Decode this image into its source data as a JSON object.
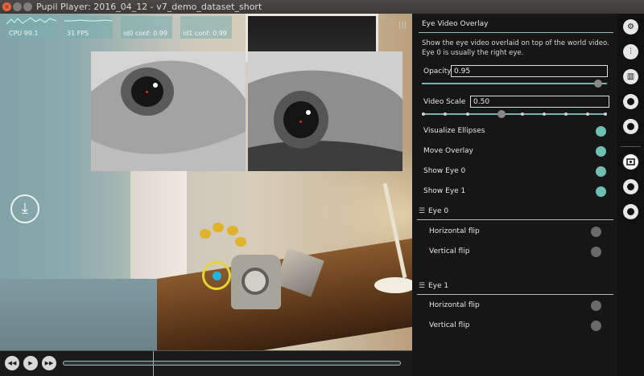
{
  "window": {
    "title": "Pupil Player: 2016_04_12 - v7_demo_dataset_short",
    "close_glyph": "×",
    "min_glyph": "",
    "max_glyph": ""
  },
  "hud": {
    "cpu": "CPU 99.1",
    "fps": "31 FPS",
    "id0": "id0 conf: 0.99",
    "id1": "id1 conf: 0.99"
  },
  "world": {
    "grip_glyph": "|||",
    "download_glyph": "⤓"
  },
  "timeline": {
    "back_glyph": "◀◀",
    "play_glyph": "▶",
    "forward_glyph": "▶▶"
  },
  "panel": {
    "title": "Eye Video Overlay",
    "description": "Show the eye video overlaid on top of the world video. Eye 0 is usually the right eye.",
    "opacity_label": "Opacity",
    "opacity_value": "0.95",
    "opacity_fraction": 0.95,
    "video_scale_label": "Video Scale",
    "video_scale_value": "0.50",
    "toggles": [
      {
        "label": "Visualize Ellipses",
        "on": true
      },
      {
        "label": "Move Overlay",
        "on": true
      },
      {
        "label": "Show Eye 0",
        "on": true
      },
      {
        "label": "Show Eye 1",
        "on": true
      }
    ],
    "eye0": {
      "title": "Eye 0",
      "horizontal_flip": "Horizontal flip",
      "vertical_flip": "Vertical flip"
    },
    "eye1": {
      "title": "Eye 1",
      "horizontal_flip": "Horizontal flip",
      "vertical_flip": "Vertical flip"
    },
    "hamburger_glyph": "☰"
  },
  "iconbar": {
    "icons": [
      "gear-icon",
      "plugin-manager-icon",
      "bar-chart-icon",
      "eye-icon-1",
      "eye-icon-2",
      "eye-overlay-icon",
      "circle-icon-1",
      "circle-icon-2"
    ],
    "gear_glyph": "⚙",
    "plugins_glyph": "⫶",
    "chart_glyph": "▥"
  },
  "colors": {
    "accent": "#6fc0b3",
    "gaze_ring": "#e6d530",
    "gaze_dot": "#1fb6e3",
    "pupil_marker": "#ff1a1a"
  }
}
